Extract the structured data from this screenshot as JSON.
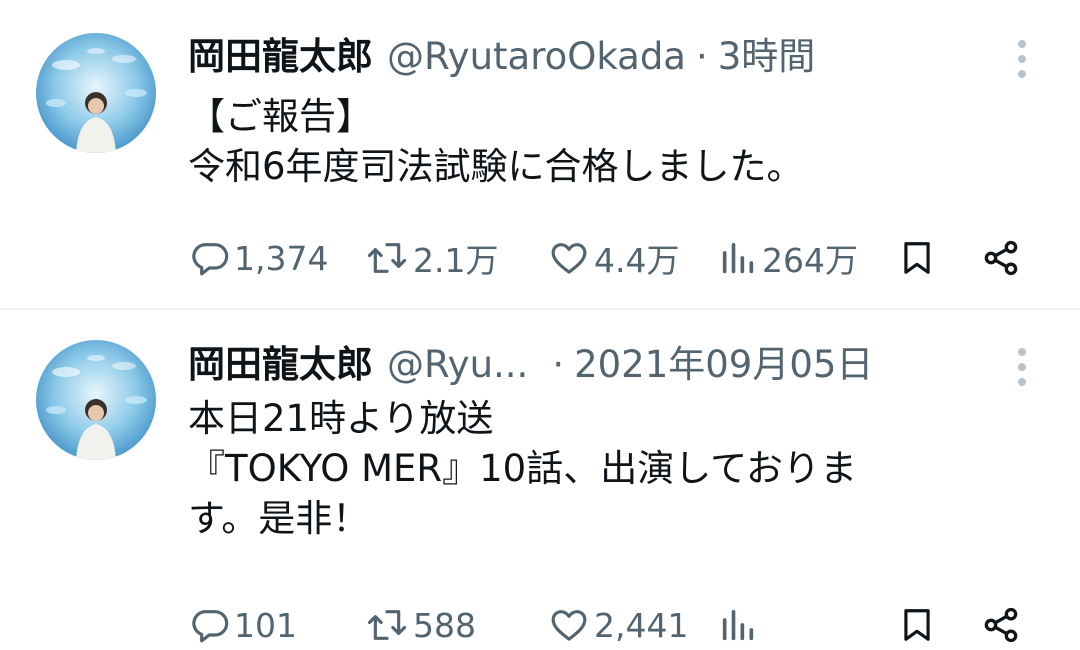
{
  "tweets": [
    {
      "name": "岡田龍太郎",
      "handle": "@RyutaroOkada",
      "separator": "·",
      "time": "3時間",
      "lines": [
        "【ご報告】",
        "令和6年度司法試験に合格しました。"
      ],
      "replies": "1,374",
      "retweets": "2.1万",
      "likes": "4.4万",
      "views": "264万"
    },
    {
      "name": "岡田龍太郎",
      "handle": "@Ryu...",
      "separator": "·",
      "time": "2021年09月05日",
      "lines": [
        "本日21時より放送",
        "『TOKYO MER』10話、出演しておりま",
        "す。是非！"
      ],
      "replies": "101",
      "retweets": "588",
      "likes": "2,441",
      "views": ""
    }
  ],
  "icons": {
    "reply": "speech-bubble",
    "retweet": "repost-arrows",
    "like": "heart",
    "views": "bar-chart",
    "bookmark": "bookmark",
    "share": "share-nodes",
    "more": "vertical-ellipsis"
  },
  "colors": {
    "text": "#0f1419",
    "secondary": "#536471",
    "divider": "#eff3f4"
  }
}
